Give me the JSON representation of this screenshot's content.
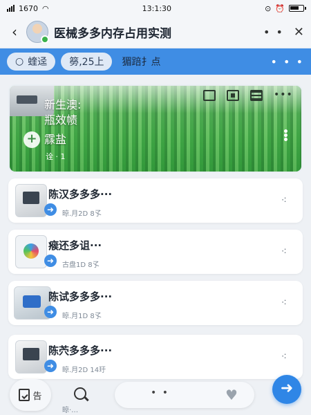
{
  "status": {
    "carrier": "1670",
    "time": "13:1:30"
  },
  "header": {
    "title": "医械多多内存占用实测"
  },
  "tabs": {
    "search_label": "蝰迳",
    "tab_2": "簩,25上",
    "tab_3": "猸踣扌点"
  },
  "hero": {
    "title": "新生澳:",
    "subtitle": "瓶效帻",
    "label": "霡盐",
    "meta": "诠 · 1"
  },
  "cards": [
    {
      "title": "陈汉多多多···",
      "meta": "晾.月2D  8孓"
    },
    {
      "title": "瘊还多诅···",
      "meta": "古盘1D  8孓"
    },
    {
      "title": "陈试多多多···",
      "meta": "晾.月1D  8孓"
    },
    {
      "title": "陈茓多多多···",
      "meta": "晾.月2D  14玗"
    }
  ],
  "bottom": {
    "left_label": "告",
    "peek_meta": "晾·…"
  },
  "colors": {
    "accent": "#3f8de4",
    "fab": "#2f86e6"
  },
  "icons": [
    "back-icon",
    "avatar",
    "more-icon",
    "close-icon",
    "search-icon",
    "layout-icon",
    "grid-icon",
    "list-icon",
    "more-dots-icon",
    "plus-icon",
    "share-icon",
    "kebab-icon",
    "doc-check-icon",
    "heart-icon",
    "arrow-right-icon"
  ]
}
